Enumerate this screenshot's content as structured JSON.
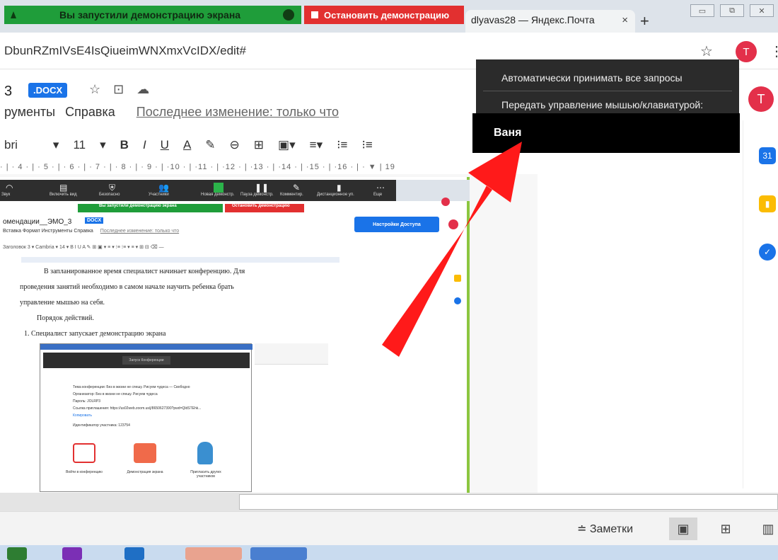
{
  "share": {
    "status_text": "Вы запустили демонстрацию экрана",
    "stop_label": "Остановить демонстрацию"
  },
  "browser": {
    "tab_title": "dlyavas28 — Яндекс.Почта",
    "tab_close": "×",
    "new_tab": "+",
    "url": "DbunRZmIVsE4IsQiueimWNXmxVcIDX/edit#",
    "avatar_letter": "T"
  },
  "docs": {
    "title_fragment": "3",
    "docx_badge": ".DOCX",
    "menu": [
      "рументы",
      "Справка"
    ],
    "last_edit": "Последнее изменение: только что",
    "font_name": "bri",
    "font_size": "11",
    "ruler_text": "· | · 4 · | · 5 · | · 6 · | · 7 · | · 8 · | · 9 · | ·10 · | ·11 · | ·12 · | ·13 · | ·14 · | ·15 · | ·16 · | · ▼   |   19",
    "avatar_letter": "T"
  },
  "dropdown": {
    "item_auto": "Автоматически принимать все запросы",
    "item_transfer": "Передать управление мышью/клавиатурой:",
    "sub_name": "Ваня"
  },
  "nested": {
    "zoom_labels": [
      "Звук",
      "Включить вид",
      "Безопасно",
      "Участники",
      "Новая демонстр.",
      "Пауза демонстр.",
      "Комментир.",
      "Дистанционное уп.",
      "Еще"
    ],
    "share_status": "Вы запустили демонстрацию экрана",
    "stop_label": "Остановить демонстрацию",
    "doc_title": "омендации__ЭМО_3",
    "docx_badge": "DOCX",
    "menu": "Вставка  Формат  Инструменты  Справка",
    "last_edit": "Последнее изменение: только что",
    "access_button": "Настройки Доступа",
    "toolbar": "Заголовок 3  ▾   Cambria   ▾   14   ▾   B  I  U  A   ✎   ⊞  ▣  ▾   ≡ ▾   ⁝≡   ⁝≡ ▾   ≡ ▾   ⊞   ⊟    ⌫  —",
    "para1": "В   запланированное   время   специалист   начинает   конференцию.   Для",
    "para2": "проведения   занятий   необходимо    в   самом   начале   научить   ребенка   брать",
    "para3": "управление мышью на себя.",
    "para4": "Порядок действий.",
    "para5": "1.   Специалист запускает демонстрацию экрана",
    "img_pill": "Запуск Конференции",
    "img_rows": [
      "Тема конференции:       Без в жизни не спешу. Рисуем чудеса — Свободно",
      "Организатор:            Без в жизни не спешу. Рисуем чудеса",
      "Пароль:                 JOLRP3",
      "Ссылка приглашения:     https://us02web.zoom.us/j/8650627390?pwd=QldSTEhk...",
      "                        Копировать",
      "Идентификатор участника: 123754"
    ],
    "img_caps": [
      "Войти в конференцию",
      "Демонстрация экрана",
      "Пригласить других участников"
    ]
  },
  "statusbar": {
    "notes": "Заметки"
  },
  "colors": {
    "share_green": "#1f9d3a",
    "stop_red": "#e23030",
    "arrow_red": "#ff1a1a",
    "accent_blue": "#1a73e8"
  }
}
